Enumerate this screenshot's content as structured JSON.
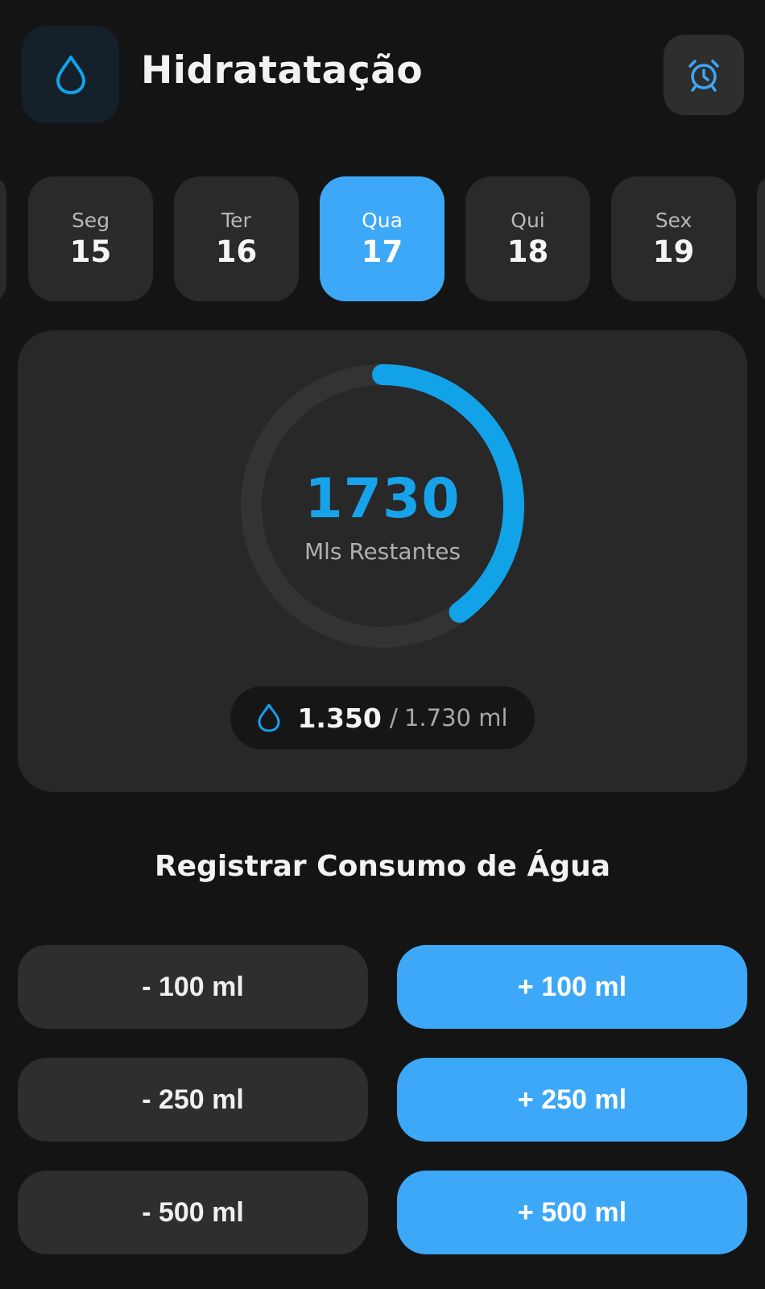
{
  "header": {
    "title": "Hidratatação",
    "logo_icon": "water-drop-icon",
    "alarm_icon": "alarm-clock-icon"
  },
  "days": [
    {
      "name": "Seg",
      "num": "15",
      "active": false
    },
    {
      "name": "Ter",
      "num": "16",
      "active": false
    },
    {
      "name": "Qua",
      "num": "17",
      "active": true
    },
    {
      "name": "Qui",
      "num": "18",
      "active": false
    },
    {
      "name": "Sex",
      "num": "19",
      "active": false
    }
  ],
  "progress": {
    "remaining": "1730",
    "remaining_label": "Mls Restantes",
    "fraction": 0.4,
    "consumed": "1.350",
    "separator": "/",
    "goal": "1.730 ml"
  },
  "register": {
    "title": "Registrar Consumo de Água",
    "minus_100": "- 100 ml",
    "plus_100": "+ 100 ml",
    "minus_250": "- 250 ml",
    "plus_250": "+ 250 ml",
    "minus_500": "- 500 ml",
    "plus_500": "+ 500 ml"
  },
  "colors": {
    "accent": "#3da8f7",
    "ring": "#12a2e8",
    "background": "#141414",
    "card": "#282828"
  }
}
